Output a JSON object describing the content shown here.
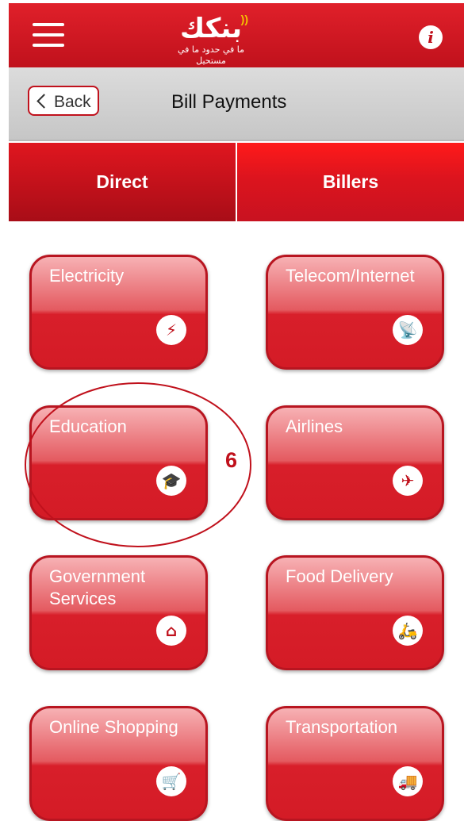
{
  "header": {
    "logo_text": "بنكك",
    "logo_tagline": "ما في حدود ما في مستحيل",
    "menu_icon": "hamburger-icon",
    "info_label": "i"
  },
  "titlebar": {
    "back_label": "Back",
    "title": "Bill Payments"
  },
  "tabs": [
    {
      "label": "Direct",
      "active": true
    },
    {
      "label": "Billers",
      "active": false
    }
  ],
  "tiles": [
    {
      "label": "Electricity",
      "icon": "lightning-icon",
      "glyph": "⚡"
    },
    {
      "label": "Telecom/Internet",
      "icon": "satellite-icon",
      "glyph": "📡"
    },
    {
      "label": "Education",
      "icon": "graduation-cap-icon",
      "glyph": "🎓"
    },
    {
      "label": "Airlines",
      "icon": "airplane-icon",
      "glyph": "✈"
    },
    {
      "label": "Government Services",
      "icon": "house-icon",
      "glyph": "⌂"
    },
    {
      "label": "Food Delivery",
      "icon": "delivery-scooter-icon",
      "glyph": "🛵"
    },
    {
      "label": "Online Shopping",
      "icon": "shopping-cart-icon",
      "glyph": "🛒"
    },
    {
      "label": "Transportation",
      "icon": "truck-icon",
      "glyph": "🚚"
    }
  ],
  "annotation": {
    "number": "6"
  },
  "colors": {
    "brand_red": "#c0111c",
    "title_gray": "#cfcfcf",
    "accent_gold": "#f5c400"
  }
}
